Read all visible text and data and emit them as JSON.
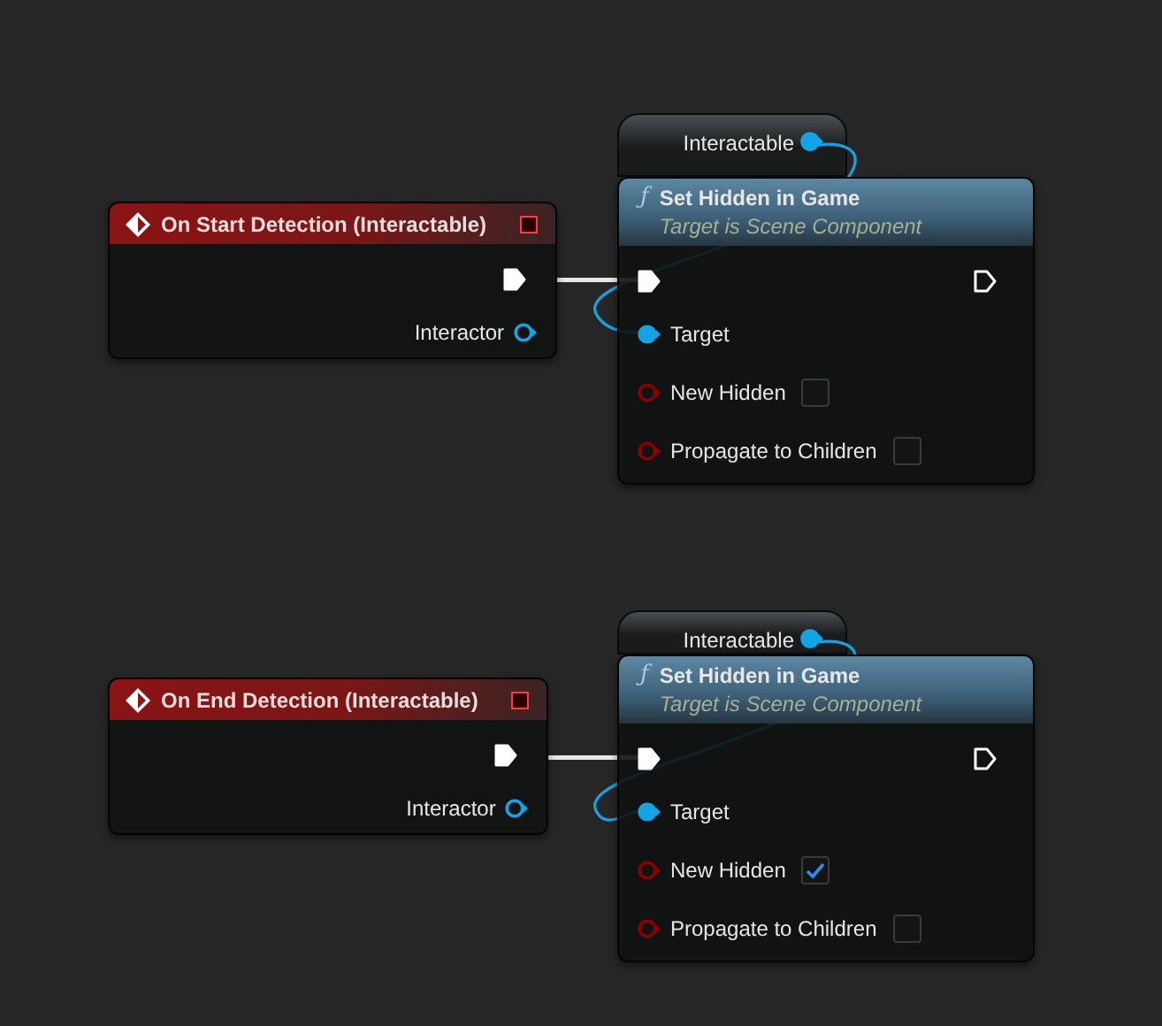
{
  "groups": [
    {
      "event": {
        "title": "On Start Detection (Interactable)",
        "exec_out": {
          "connected": true
        },
        "pins": [
          {
            "label": "Interactor",
            "connected": false
          }
        ]
      },
      "variable": {
        "label": "Interactable",
        "connected": true
      },
      "function": {
        "icon": "ƒ",
        "title": "Set Hidden in Game",
        "subtitle": "Target is Scene Component",
        "exec_in": {
          "connected": true
        },
        "exec_out": {
          "connected": false
        },
        "params": [
          {
            "label": "Target",
            "kind": "object",
            "connected": true
          },
          {
            "label": "New Hidden",
            "kind": "bool",
            "connected": false,
            "checked": false
          },
          {
            "label": "Propagate to Children",
            "kind": "bool",
            "connected": false,
            "checked": false
          }
        ]
      }
    },
    {
      "event": {
        "title": "On End Detection (Interactable)",
        "exec_out": {
          "connected": true
        },
        "pins": [
          {
            "label": "Interactor",
            "connected": false
          }
        ]
      },
      "variable": {
        "label": "Interactable",
        "connected": true
      },
      "function": {
        "icon": "ƒ",
        "title": "Set Hidden in Game",
        "subtitle": "Target is Scene Component",
        "exec_in": {
          "connected": true
        },
        "exec_out": {
          "connected": false
        },
        "params": [
          {
            "label": "Target",
            "kind": "object",
            "connected": true
          },
          {
            "label": "New Hidden",
            "kind": "bool",
            "connected": false,
            "checked": true
          },
          {
            "label": "Propagate to Children",
            "kind": "bool",
            "connected": false,
            "checked": false
          }
        ]
      }
    }
  ]
}
